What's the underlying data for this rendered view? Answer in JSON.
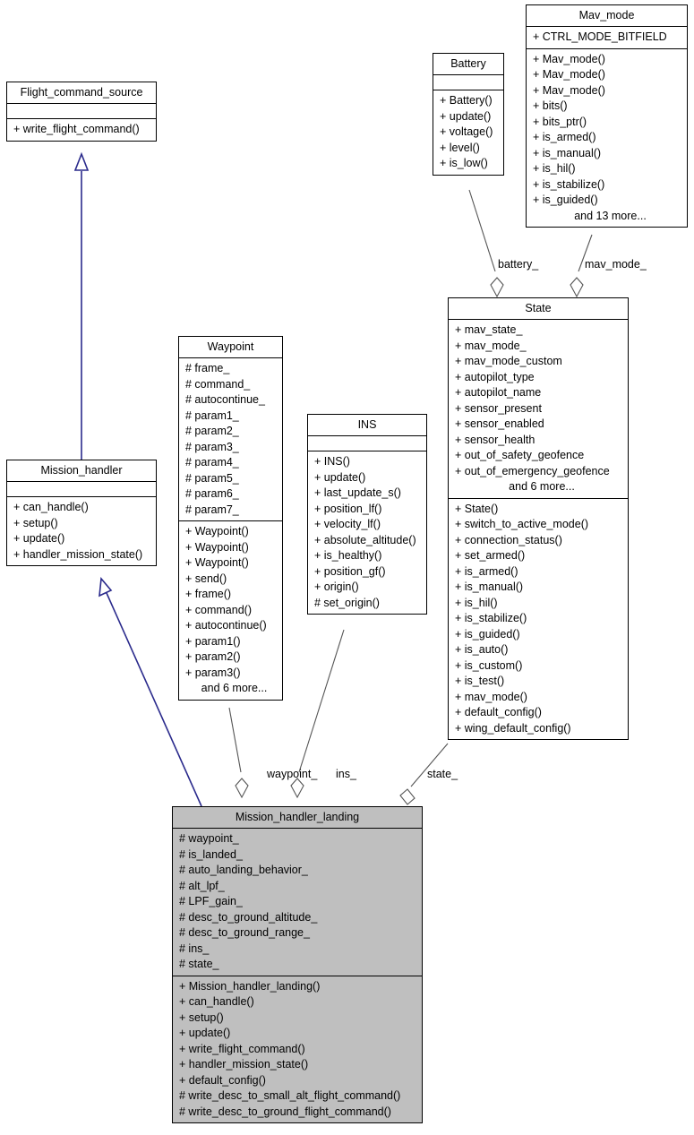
{
  "diagram": {
    "title": "Mission_handler_landing collaboration diagram",
    "type": "uml-class-diagram",
    "colors": {
      "inheritance_line": "#2a2a8c",
      "aggregation_line": "#555555",
      "highlight_fill": "#bfbfbf",
      "border": "#000000",
      "background": "#ffffff"
    }
  },
  "classes": {
    "flight_command_source": {
      "name": "Flight_command_source",
      "attributes": [],
      "methods": [
        "+ write_flight_command()"
      ]
    },
    "mission_handler": {
      "name": "Mission_handler",
      "attributes": [],
      "methods": [
        "+ can_handle()",
        "+ setup()",
        "+ update()",
        "+ handler_mission_state()"
      ]
    },
    "waypoint": {
      "name": "Waypoint",
      "attributes": [
        "# frame_",
        "# command_",
        "# autocontinue_",
        "# param1_",
        "# param2_",
        "# param3_",
        "# param4_",
        "# param5_",
        "# param6_",
        "# param7_"
      ],
      "methods": [
        "+ Waypoint()",
        "+ Waypoint()",
        "+ Waypoint()",
        "+ send()",
        "+ frame()",
        "+ command()",
        "+ autocontinue()",
        "+ param1()",
        "+ param2()",
        "+ param3()"
      ],
      "methods_more": "and 6 more..."
    },
    "ins": {
      "name": "INS",
      "attributes": [],
      "methods": [
        "+ INS()",
        "+ update()",
        "+ last_update_s()",
        "+ position_lf()",
        "+ velocity_lf()",
        "+ absolute_altitude()",
        "+ is_healthy()",
        "+ position_gf()",
        "+ origin()",
        "# set_origin()"
      ]
    },
    "battery": {
      "name": "Battery",
      "attributes": [],
      "methods": [
        "+ Battery()",
        "+ update()",
        "+ voltage()",
        "+ level()",
        "+ is_low()"
      ]
    },
    "mav_mode": {
      "name": "Mav_mode",
      "attributes": [
        "+ CTRL_MODE_BITFIELD"
      ],
      "methods": [
        "+ Mav_mode()",
        "+ Mav_mode()",
        "+ Mav_mode()",
        "+ bits()",
        "+ bits_ptr()",
        "+ is_armed()",
        "+ is_manual()",
        "+ is_hil()",
        "+ is_stabilize()",
        "+ is_guided()"
      ],
      "methods_more": "and 13 more..."
    },
    "state": {
      "name": "State",
      "attributes": [
        "+ mav_state_",
        "+ mav_mode_",
        "+ mav_mode_custom",
        "+ autopilot_type",
        "+ autopilot_name",
        "+ sensor_present",
        "+ sensor_enabled",
        "+ sensor_health",
        "+ out_of_safety_geofence",
        "+ out_of_emergency_geofence"
      ],
      "attributes_more": "and 6 more...",
      "methods": [
        "+ State()",
        "+ switch_to_active_mode()",
        "+ connection_status()",
        "+ set_armed()",
        "+ is_armed()",
        "+ is_manual()",
        "+ is_hil()",
        "+ is_stabilize()",
        "+ is_guided()",
        "+ is_auto()",
        "+ is_custom()",
        "+ is_test()",
        "+ mav_mode()",
        "+ default_config()",
        "+ wing_default_config()"
      ]
    },
    "mission_handler_landing": {
      "name": "Mission_handler_landing",
      "attributes": [
        "# waypoint_",
        "# is_landed_",
        "# auto_landing_behavior_",
        "# alt_lpf_",
        "# LPF_gain_",
        "# desc_to_ground_altitude_",
        "# desc_to_ground_range_",
        "# ins_",
        "# state_"
      ],
      "methods": [
        "+ Mission_handler_landing()",
        "+ can_handle()",
        "+ setup()",
        "+ update()",
        "+ write_flight_command()",
        "+ handler_mission_state()",
        "+ default_config()",
        "# write_desc_to_small_alt_flight_command()",
        "# write_desc_to_ground_flight_command()"
      ]
    }
  },
  "edge_labels": {
    "battery": "battery_",
    "mav_mode": "mav_mode_",
    "waypoint": "waypoint_",
    "ins": "ins_",
    "state": "state_"
  }
}
